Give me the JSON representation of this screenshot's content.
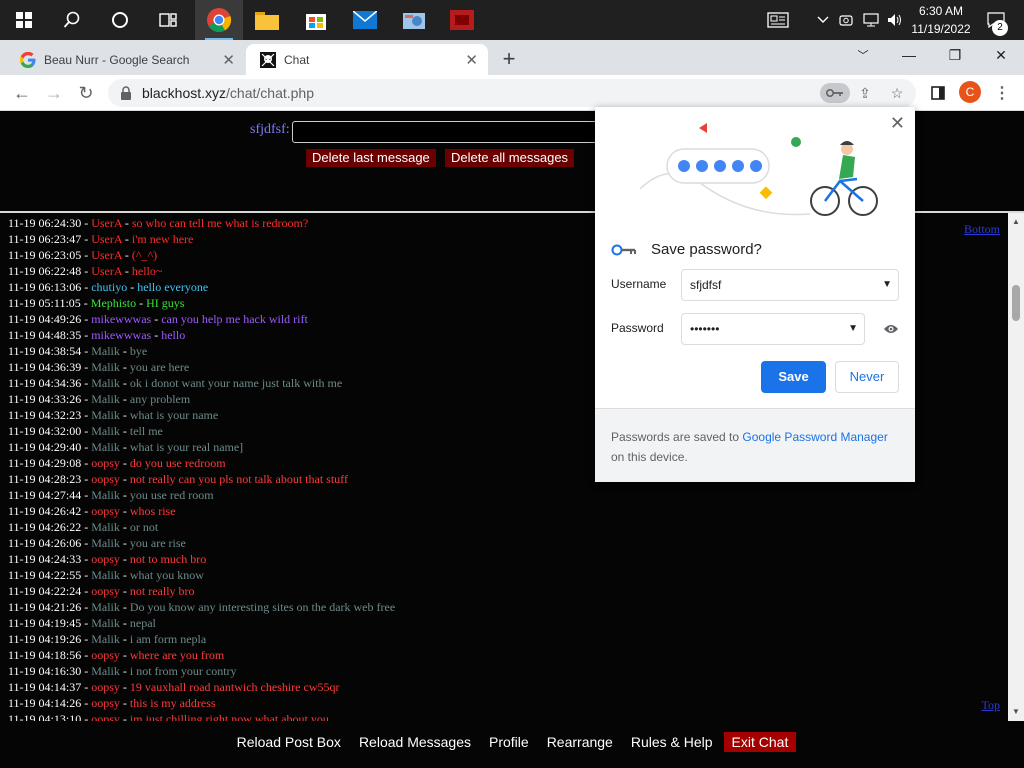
{
  "taskbar": {
    "time": "6:30 AM",
    "date": "11/19/2022",
    "notification_count": "2"
  },
  "browser": {
    "tabs": [
      {
        "title": "Beau Nurr - Google Search"
      },
      {
        "title": "Chat"
      }
    ],
    "url_domain": "blackhost.xyz",
    "url_path": "/chat/chat.php",
    "profile_initial": "C"
  },
  "chat_page": {
    "user_label": "sfjdfsf:",
    "delete_last_label": "Delete last message",
    "delete_all_label": "Delete all messages",
    "bottom_link": "Bottom",
    "top_link": "Top",
    "nav": {
      "reload_post": "Reload Post Box",
      "reload_messages": "Reload Messages",
      "profile": "Profile",
      "rearrange": "Rearrange",
      "rules": "Rules & Help",
      "exit": "Exit Chat"
    },
    "colors": {
      "userA": "#ff2b2b",
      "chutiyo": "#3ec3f5",
      "mephisto": "#39e339",
      "mikewwwas": "#9b5cff",
      "malik": "#6e8a8a",
      "oopsy": "#ff3a3a"
    },
    "messages": [
      {
        "ts": "11-19 06:24:30",
        "user": "UserA",
        "text": "so who can tell me what is redroom?",
        "color": "#ff2b2b"
      },
      {
        "ts": "11-19 06:23:47",
        "user": "UserA",
        "text": "i'm new here",
        "color": "#ff2b2b"
      },
      {
        "ts": "11-19 06:23:05",
        "user": "UserA",
        "text": "(^_^)",
        "color": "#ff2b2b"
      },
      {
        "ts": "11-19 06:22:48",
        "user": "UserA",
        "text": "hello~",
        "color": "#ff2b2b"
      },
      {
        "ts": "11-19 06:13:06",
        "user": "chutiyo",
        "text": "hello everyone",
        "color": "#3ec3f5"
      },
      {
        "ts": "11-19 05:11:05",
        "user": "Mephisto",
        "text": "HI guys",
        "color": "#39e339"
      },
      {
        "ts": "11-19 04:49:26",
        "user": "mikewwwas",
        "text": "can you help me hack wild rift",
        "color": "#9b5cff"
      },
      {
        "ts": "11-19 04:48:35",
        "user": "mikewwwas",
        "text": "hello",
        "color": "#9b5cff"
      },
      {
        "ts": "11-19 04:38:54",
        "user": "Malik",
        "text": "bye",
        "color": "#6e8a8a"
      },
      {
        "ts": "11-19 04:36:39",
        "user": "Malik",
        "text": "you are here",
        "color": "#6e8a8a"
      },
      {
        "ts": "11-19 04:34:36",
        "user": "Malik",
        "text": "ok i donot want your name just talk with me",
        "color": "#6e8a8a"
      },
      {
        "ts": "11-19 04:33:26",
        "user": "Malik",
        "text": "any problem",
        "color": "#6e8a8a"
      },
      {
        "ts": "11-19 04:32:23",
        "user": "Malik",
        "text": "what is your name",
        "color": "#6e8a8a"
      },
      {
        "ts": "11-19 04:32:00",
        "user": "Malik",
        "text": "tell me",
        "color": "#6e8a8a"
      },
      {
        "ts": "11-19 04:29:40",
        "user": "Malik",
        "text": "what is your real name]",
        "color": "#6e8a8a"
      },
      {
        "ts": "11-19 04:29:08",
        "user": "oopsy",
        "text": "do you use redroom",
        "color": "#ff3a3a"
      },
      {
        "ts": "11-19 04:28:23",
        "user": "oopsy",
        "text": "not really can you pls not talk about that stuff",
        "color": "#ff3a3a"
      },
      {
        "ts": "11-19 04:27:44",
        "user": "Malik",
        "text": "you use red room",
        "color": "#6e8a8a"
      },
      {
        "ts": "11-19 04:26:42",
        "user": "oopsy",
        "text": "whos rise",
        "color": "#ff3a3a"
      },
      {
        "ts": "11-19 04:26:22",
        "user": "Malik",
        "text": "or not",
        "color": "#6e8a8a"
      },
      {
        "ts": "11-19 04:26:06",
        "user": "Malik",
        "text": "you are rise",
        "color": "#6e8a8a"
      },
      {
        "ts": "11-19 04:24:33",
        "user": "oopsy",
        "text": "not to much bro",
        "color": "#ff3a3a"
      },
      {
        "ts": "11-19 04:22:55",
        "user": "Malik",
        "text": "what you know",
        "color": "#6e8a8a"
      },
      {
        "ts": "11-19 04:22:24",
        "user": "oopsy",
        "text": "not really bro",
        "color": "#ff3a3a"
      },
      {
        "ts": "11-19 04:21:26",
        "user": "Malik",
        "text": "Do you know any interesting sites on the dark web free",
        "color": "#6e8a8a"
      },
      {
        "ts": "11-19 04:19:45",
        "user": "Malik",
        "text": "nepal",
        "color": "#6e8a8a"
      },
      {
        "ts": "11-19 04:19:26",
        "user": "Malik",
        "text": "i am form nepla",
        "color": "#6e8a8a"
      },
      {
        "ts": "11-19 04:18:56",
        "user": "oopsy",
        "text": "where are you from",
        "color": "#ff3a3a"
      },
      {
        "ts": "11-19 04:16:30",
        "user": "Malik",
        "text": "i not from your contry",
        "color": "#6e8a8a"
      },
      {
        "ts": "11-19 04:14:37",
        "user": "oopsy",
        "text": "19 vauxhall road nantwich cheshire cw55qr",
        "color": "#ff3a3a"
      },
      {
        "ts": "11-19 04:14:26",
        "user": "oopsy",
        "text": "this is my address",
        "color": "#ff3a3a"
      },
      {
        "ts": "11-19 04:13:10",
        "user": "oopsy",
        "text": "im just chilling right now what about you",
        "color": "#ff3a3a"
      }
    ]
  },
  "password_popup": {
    "title": "Save password?",
    "username_label": "Username",
    "username_value": "sfjdfsf",
    "password_label": "Password",
    "password_value": "•••••••",
    "save_label": "Save",
    "never_label": "Never",
    "footer_prefix": "Passwords are saved to ",
    "footer_link": "Google Password Manager",
    "footer_suffix": " on this device."
  }
}
